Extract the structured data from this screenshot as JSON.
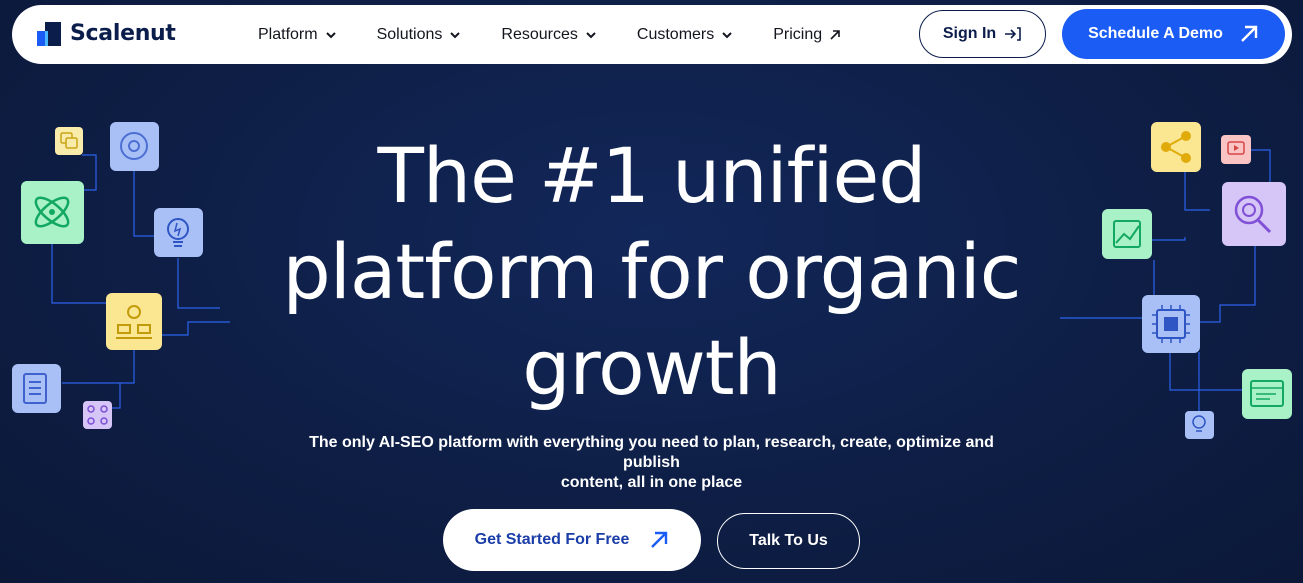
{
  "brand": {
    "name": "Scalenut"
  },
  "nav": {
    "items": [
      {
        "label": "Platform",
        "icon": "chevron-down-icon"
      },
      {
        "label": "Solutions",
        "icon": "chevron-down-icon"
      },
      {
        "label": "Resources",
        "icon": "chevron-down-icon"
      },
      {
        "label": "Customers",
        "icon": "chevron-down-icon"
      },
      {
        "label": "Pricing",
        "icon": "arrow-up-right-icon"
      }
    ],
    "signin_label": "Sign In",
    "demo_label": "Schedule A Demo"
  },
  "hero": {
    "headline_line1": "The #1 unified",
    "headline_line2": "platform for organic",
    "headline_line3": "growth",
    "subtitle_line1": "The only AI-SEO platform with everything you need to plan, research, create, optimize and publish",
    "subtitle_line2": "content, all in one place",
    "cta_primary": "Get Started For Free",
    "cta_secondary": "Talk To Us"
  },
  "colors": {
    "background": "#0e1e45",
    "accent": "#1b5cf4",
    "navy": "#0b1d4b",
    "circuit_line": "#2f6bff"
  },
  "decor_icons_left": [
    "image-icon",
    "settings-cloud-icon",
    "atom-icon",
    "lightbulb-icon",
    "team-icon",
    "document-icon",
    "workflow-icon"
  ],
  "decor_icons_right": [
    "share-icon",
    "video-icon",
    "chart-icon",
    "search-target-icon",
    "chip-icon",
    "browser-icon",
    "bulb-small-icon"
  ]
}
